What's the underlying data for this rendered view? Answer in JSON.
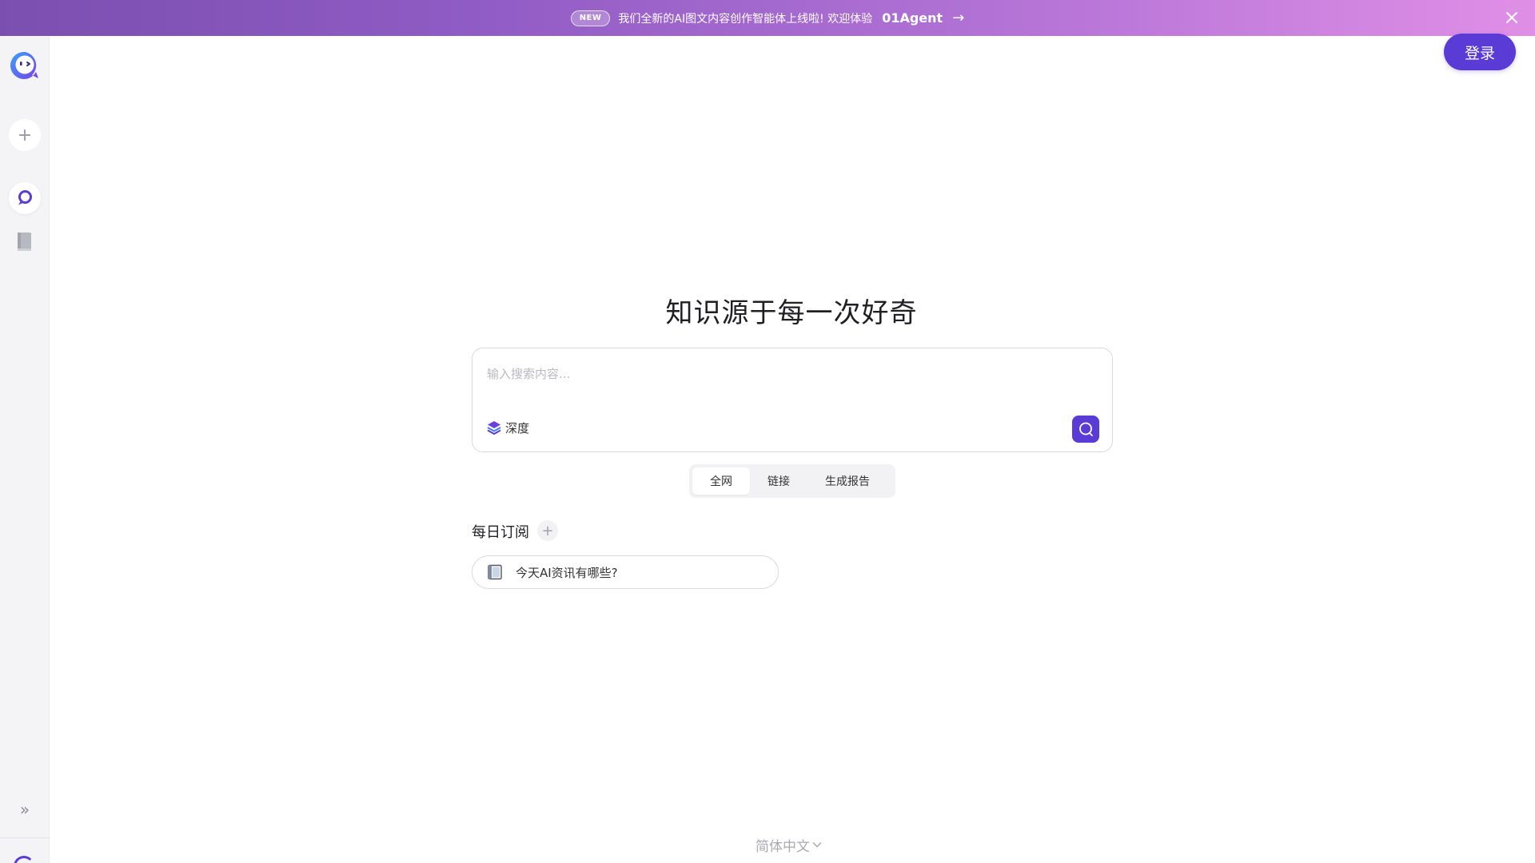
{
  "banner": {
    "badge": "NEW",
    "text": "我们全新的AI图文内容创作智能体上线啦! 欢迎体验",
    "agent": "01Agent",
    "arrow": "→",
    "gradient_start": "#7b4fb0",
    "gradient_end": "#e08fe6",
    "close_icon": "close-icon"
  },
  "sidebar": {
    "logo_icon": "bot-logo-icon",
    "new_chat_icon": "plus-icon",
    "new_chat_symbol": "+",
    "items": [
      {
        "icon": "search-chat-icon",
        "active": true
      },
      {
        "icon": "book-icon",
        "active": false
      }
    ],
    "expand_icon": "double-chevron-right-icon",
    "expand_symbol": "»"
  },
  "header": {
    "login_label": "登录"
  },
  "hero": {
    "title": "知识源于每一次好奇"
  },
  "search": {
    "placeholder": "输入搜索内容...",
    "value": "",
    "deep_label": "深度",
    "deep_icon": "layers-icon",
    "submit_icon": "search-icon"
  },
  "scope_tabs": {
    "items": [
      {
        "label": "全网",
        "active": true
      },
      {
        "label": "链接",
        "active": false
      },
      {
        "label": "生成报告",
        "active": false
      }
    ]
  },
  "daily": {
    "title": "每日订阅",
    "add_symbol": "+",
    "items": [
      {
        "icon": "notebook-icon",
        "label": "今天AI资讯有哪些?"
      }
    ]
  },
  "footer": {
    "language": "简体中文",
    "language_icon": "chevron-down-icon"
  },
  "colors": {
    "accent": "#5b3bd6",
    "sidebar_bg": "#f4f4f6",
    "border": "#d9d9e0"
  }
}
